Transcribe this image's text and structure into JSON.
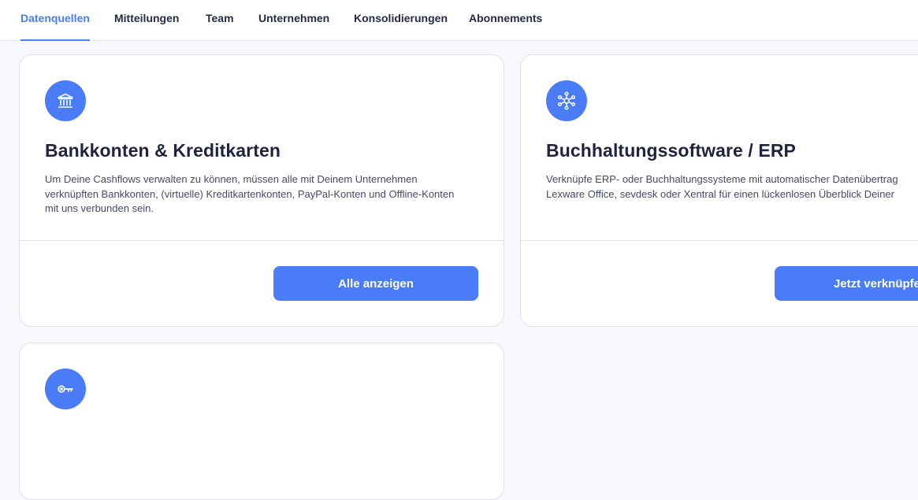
{
  "tabs": [
    {
      "label": "Datenquellen",
      "active": true
    },
    {
      "label": "Mitteilungen"
    },
    {
      "label": "Team"
    },
    {
      "label": "Unternehmen"
    },
    {
      "label": "Konsolidierungen"
    },
    {
      "label": "Abonnements"
    }
  ],
  "cards": {
    "bank": {
      "icon": "bank-icon",
      "title": "Bankkonten & Kreditkarten",
      "description": "Um Deine Cashflows verwalten zu können, müssen alle mit Deinem Unternehmen verknüpften Bankkonten, (virtuelle) Kreditkartenkonten, PayPal-Konten und Offline-Konten mit uns verbunden sein.",
      "button": "Alle anzeigen"
    },
    "erp": {
      "icon": "network-icon",
      "title": "Buchhaltungssoftware / ERP",
      "description_line1": "Verknüpfe ERP- oder Buchhaltungssysteme mit automatischer Datenübertrag",
      "description_line2": "Lexware Office, sevdesk oder Xentral für einen lückenlosen Überblick Deiner",
      "button": "Jetzt verknüpfe"
    },
    "api": {
      "icon": "key-icon"
    }
  },
  "colors": {
    "accent": "#4a7cf7",
    "text": "#1f2340",
    "background": "#f7f8fc"
  }
}
